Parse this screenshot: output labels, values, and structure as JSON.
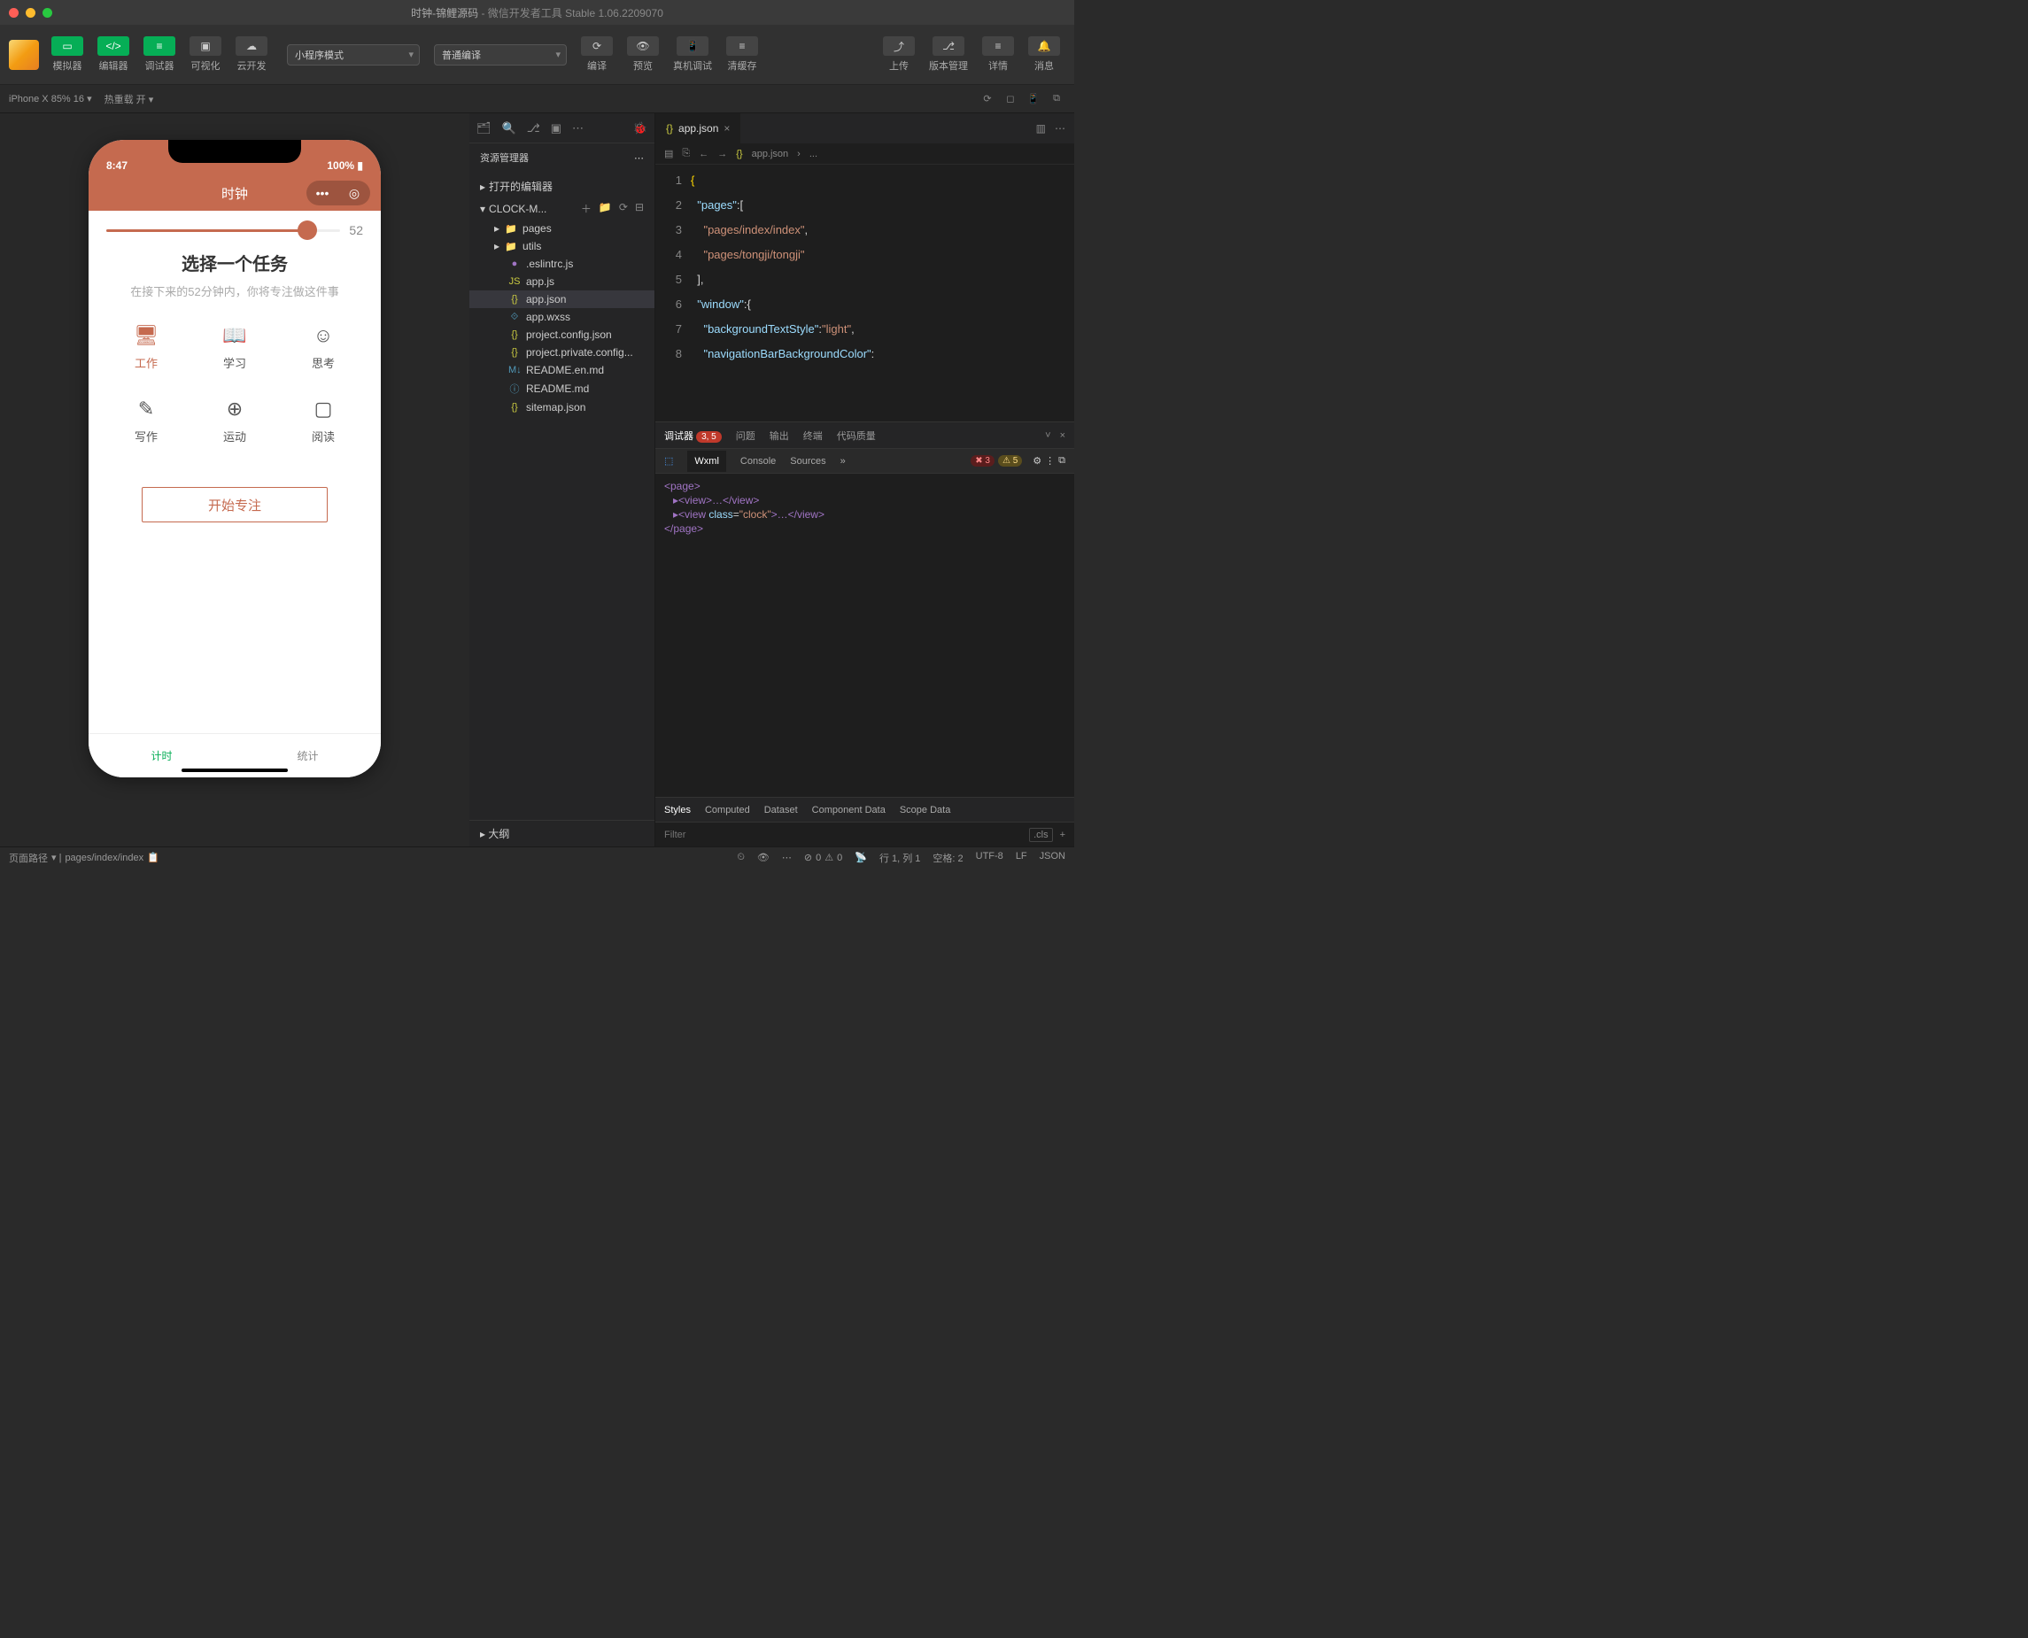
{
  "titlebar": {
    "project": "时钟-锦鲤源码",
    "app": "微信开发者工具 Stable 1.06.2209070"
  },
  "toolbar": {
    "simulator": "模拟器",
    "editor": "编辑器",
    "debugger": "调试器",
    "visualize": "可视化",
    "cloud": "云开发",
    "mode": "小程序模式",
    "compile_mode": "普通编译",
    "compile": "编译",
    "preview": "预览",
    "remote_debug": "真机调试",
    "clear_cache": "清缓存",
    "upload": "上传",
    "version": "版本管理",
    "details": "详情",
    "messages": "消息"
  },
  "subbar": {
    "device": "iPhone X 85% 16",
    "hot_reload": "热重载 开"
  },
  "simulator": {
    "time": "8:47",
    "battery": "100%",
    "app_title": "时钟",
    "slider_value": "52",
    "task_heading": "选择一个任务",
    "task_sub": "在接下来的52分钟内，你将专注做这件事",
    "tasks": [
      "工作",
      "学习",
      "思考",
      "写作",
      "运动",
      "阅读"
    ],
    "start_button": "开始专注",
    "tab_timer": "计时",
    "tab_stats": "统计"
  },
  "explorer": {
    "title": "资源管理器",
    "opened_editors": "打开的编辑器",
    "project": "CLOCK-M...",
    "folders": [
      "pages",
      "utils"
    ],
    "files": [
      ".eslintrc.js",
      "app.js",
      "app.json",
      "app.wxss",
      "project.config.json",
      "project.private.config...",
      "README.en.md",
      "README.md",
      "sitemap.json"
    ],
    "outline": "大纲"
  },
  "editor": {
    "tab": "app.json",
    "breadcrumb_file": "app.json",
    "breadcrumb_suffix": "...",
    "code": {
      "pages_key": "pages",
      "page1": "pages/index/index",
      "page2": "pages/tongji/tongji",
      "window_key": "window",
      "bg_key": "backgroundTextStyle",
      "bg_val": "light",
      "nav_key": "navigationBarBackgroundColor"
    }
  },
  "debugger": {
    "tab_debugger": "调试器",
    "badge": "3, 5",
    "tab_problems": "问题",
    "tab_output": "输出",
    "tab_terminal": "终端",
    "tab_quality": "代码质量",
    "devtools": {
      "wxml": "Wxml",
      "console": "Console",
      "sources": "Sources",
      "errors": "3",
      "warnings": "5"
    },
    "wxml_lines": {
      "page_open": "<page>",
      "view1": "▸<view>…</view>",
      "view2_pre": "▸<view ",
      "view2_attr": "class",
      "view2_val": "clock",
      "view2_post": ">…</view>",
      "page_close": "</page>"
    },
    "styles_tabs": [
      "Styles",
      "Computed",
      "Dataset",
      "Component Data",
      "Scope Data"
    ],
    "filter_placeholder": "Filter",
    "cls": ".cls"
  },
  "statusbar": {
    "page_path_label": "页面路径",
    "page_path": "pages/index/index",
    "errors": "0",
    "warnings": "0",
    "cursor": "行 1, 列 1",
    "spaces": "空格: 2",
    "encoding": "UTF-8",
    "eol": "LF",
    "lang": "JSON"
  }
}
